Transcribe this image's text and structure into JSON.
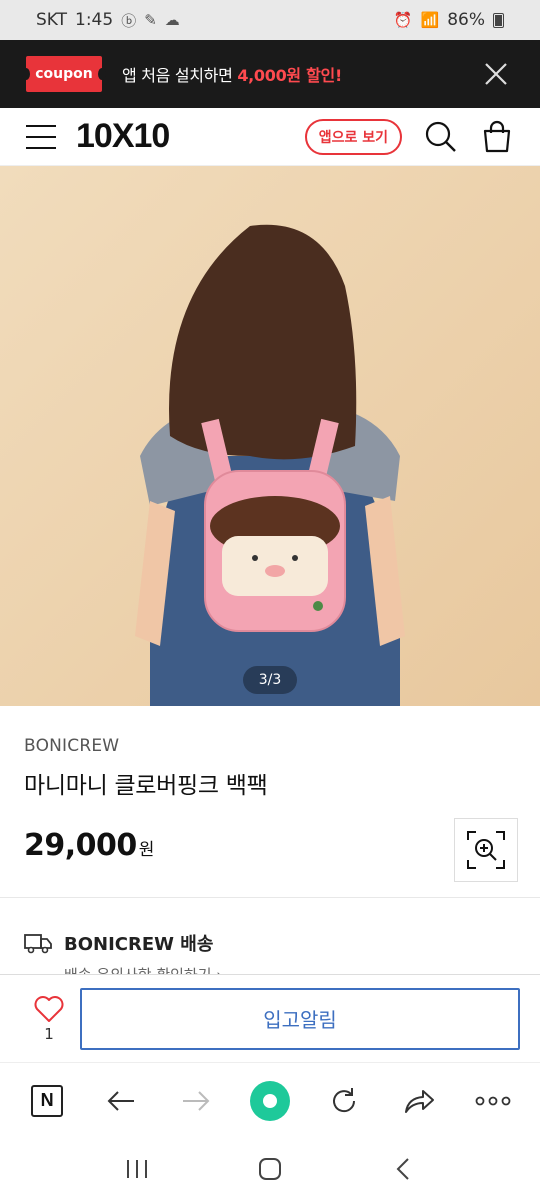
{
  "status_bar": {
    "carrier": "SKT",
    "time": "1:45",
    "battery": "86%"
  },
  "coupon_banner": {
    "badge": "coupon",
    "text_prefix": "앱 처음 설치하면 ",
    "text_highlight": "4,000원 할인!"
  },
  "header": {
    "logo": "10X10",
    "app_view_label": "앱으로 보기"
  },
  "hero": {
    "page_indicator": "3/3",
    "colors": {
      "background": "#efd7b2",
      "backpack": "#f3a4b3"
    }
  },
  "product": {
    "brand": "BONICREW",
    "name": "마니마니 클로버핑크 백팩",
    "price": "29,000",
    "currency": "원"
  },
  "shipping": {
    "label": "BONICREW 배송",
    "sub": "배송 유의사항 확인하기 ›"
  },
  "action_bar": {
    "wish_count": "1",
    "restock_label": "입고알림"
  },
  "browser_bar": {
    "n_label": "N"
  },
  "colors": {
    "accent_red": "#e8343a",
    "button_blue": "#3d6fc0",
    "browser_green": "#1ec99a"
  }
}
